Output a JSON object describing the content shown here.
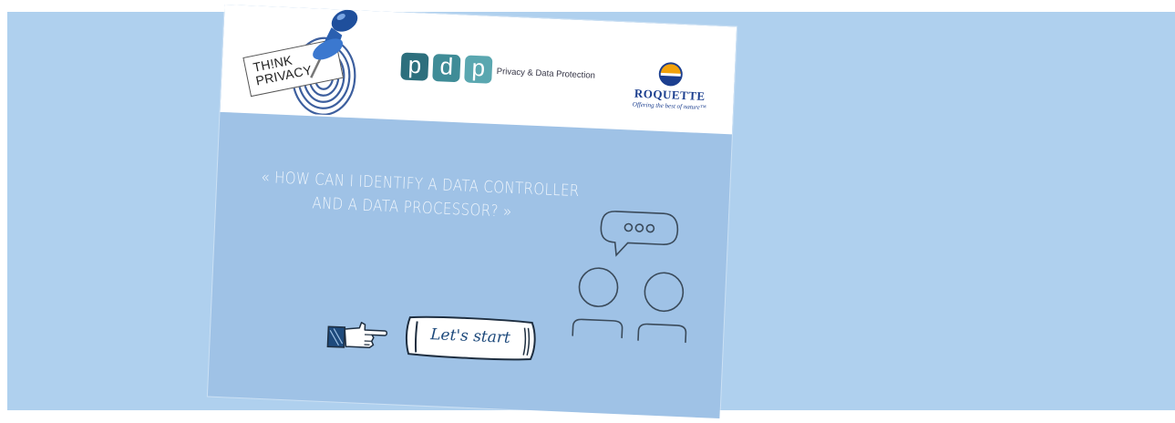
{
  "header": {
    "think_privacy": {
      "line1": "TH!NK",
      "line2": "PRIVACY"
    },
    "pdp": {
      "letters": [
        "p",
        "d",
        "p"
      ],
      "text": "Privacy & Data Protection",
      "colors": [
        "#2d6f7d",
        "#3f8c97",
        "#5aa7b0"
      ]
    },
    "roquette": {
      "name": "ROQUETTE",
      "tagline": "Offering the best of nature™",
      "color": "#1c3f8f",
      "accent": "#f2a20b"
    }
  },
  "main": {
    "question_line1": "« HOW CAN I IDENTIFY A DATA CONTROLLER",
    "question_line2": "AND A DATA PROCESSOR? »",
    "start_button": "Let's start",
    "bubble_icon": "chat-bubble-icon",
    "people_icon": "people-icon",
    "hand_icon": "pointing-hand-icon"
  },
  "colors": {
    "background": "#afd0ee",
    "card": "#9fc2e6",
    "pin": "#2a5fb0"
  }
}
